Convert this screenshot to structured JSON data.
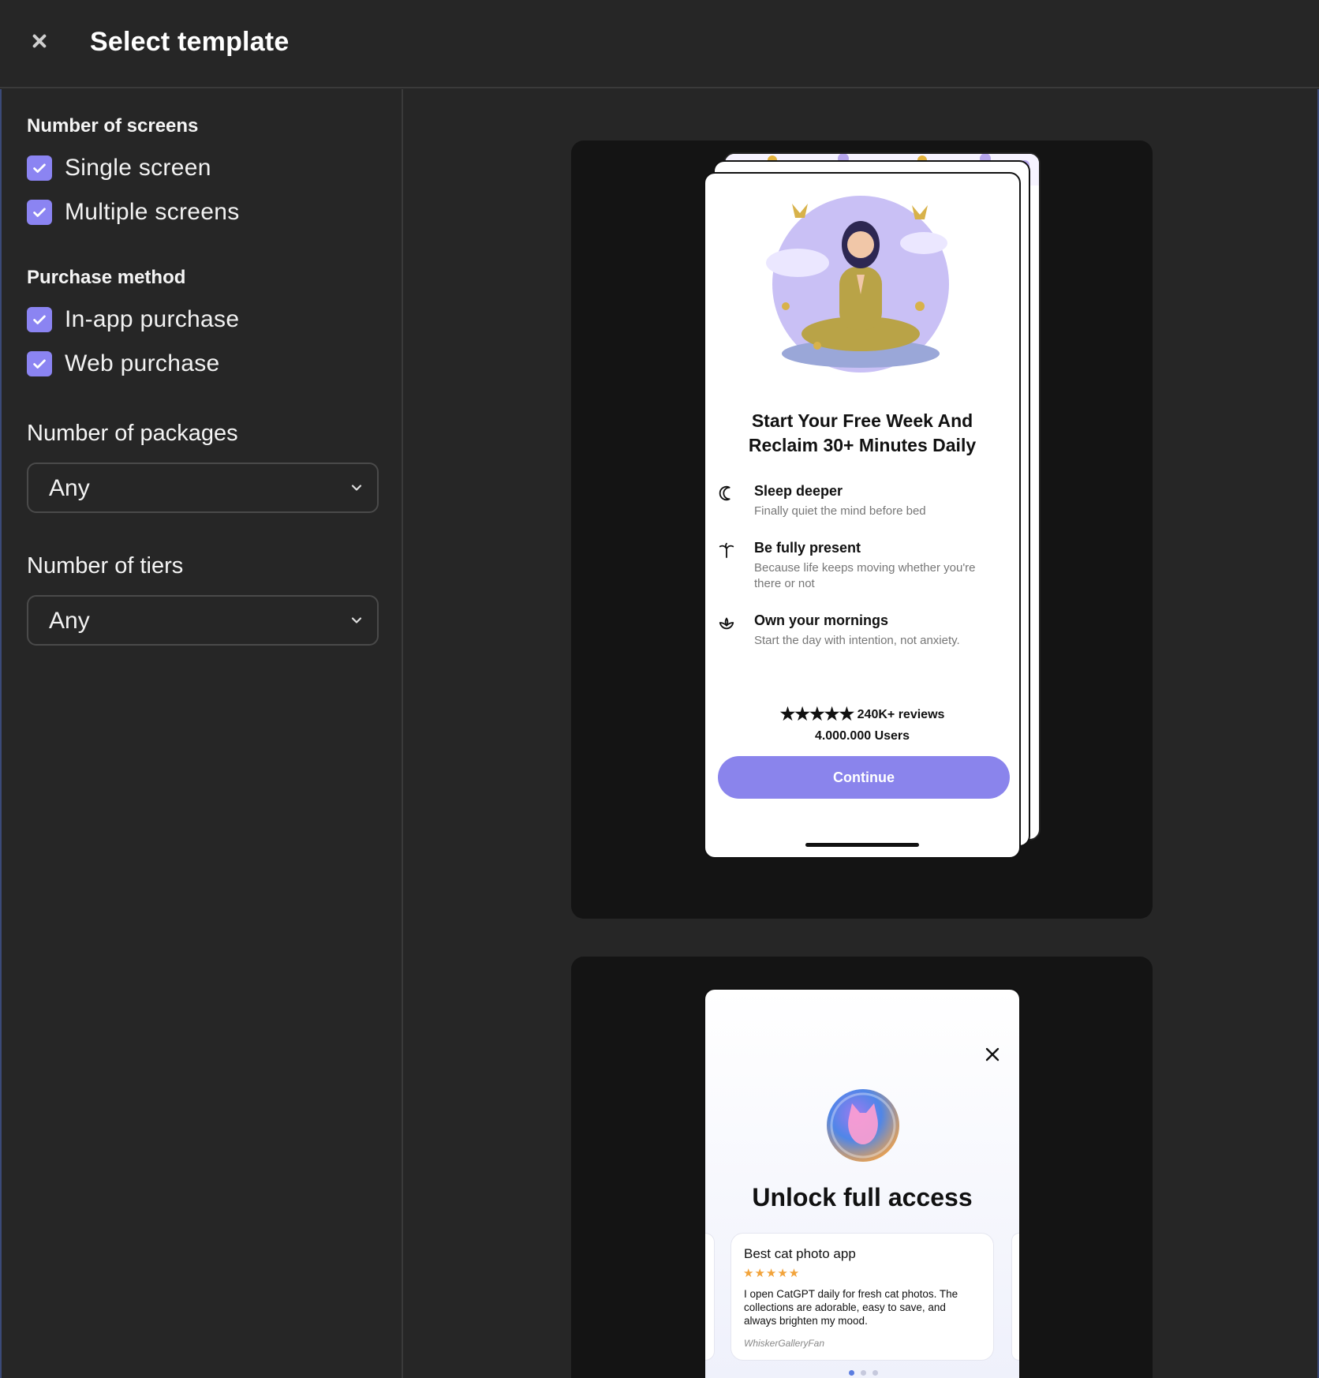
{
  "header": {
    "title": "Select template",
    "close_icon": "close-icon"
  },
  "sidebar": {
    "screens": {
      "title": "Number of screens",
      "options": [
        {
          "label": "Single screen",
          "checked": true
        },
        {
          "label": "Multiple screens",
          "checked": true
        }
      ]
    },
    "purchase": {
      "title": "Purchase method",
      "options": [
        {
          "label": "In-app purchase",
          "checked": true
        },
        {
          "label": "Web purchase",
          "checked": true
        }
      ]
    },
    "packages": {
      "title": "Number of packages",
      "value": "Any"
    },
    "tiers": {
      "title": "Number of tiers",
      "value": "Any"
    }
  },
  "templates": [
    {
      "headline_line1": "Start Your Free Week And",
      "headline_line2": "Reclaim 30+ Minutes Daily",
      "features": [
        {
          "icon": "moon-icon",
          "title": "Sleep deeper",
          "desc": "Finally quiet the mind before bed"
        },
        {
          "icon": "palm-icon",
          "title": "Be fully present",
          "desc": "Because life keeps moving whether you're there or not"
        },
        {
          "icon": "lotus-icon",
          "title": "Own your mornings",
          "desc": "Start the day with intention, not anxiety."
        }
      ],
      "stars": "★★★★★",
      "reviews": "240K+ reviews",
      "users": "4.000.000 Users",
      "cta": "Continue"
    },
    {
      "headline": "Unlock full access",
      "review": {
        "title": "Best cat photo app",
        "stars": "★★★★★",
        "text": "I open CatGPT daily for fresh cat photos. The collections are adorable, easy to save, and always brighten my mood.",
        "author": "WhiskerGalleryFan"
      }
    }
  ],
  "colors": {
    "accent": "#8B84F2",
    "cta": "#8A84EC",
    "star_gold": "#F2A33A"
  }
}
